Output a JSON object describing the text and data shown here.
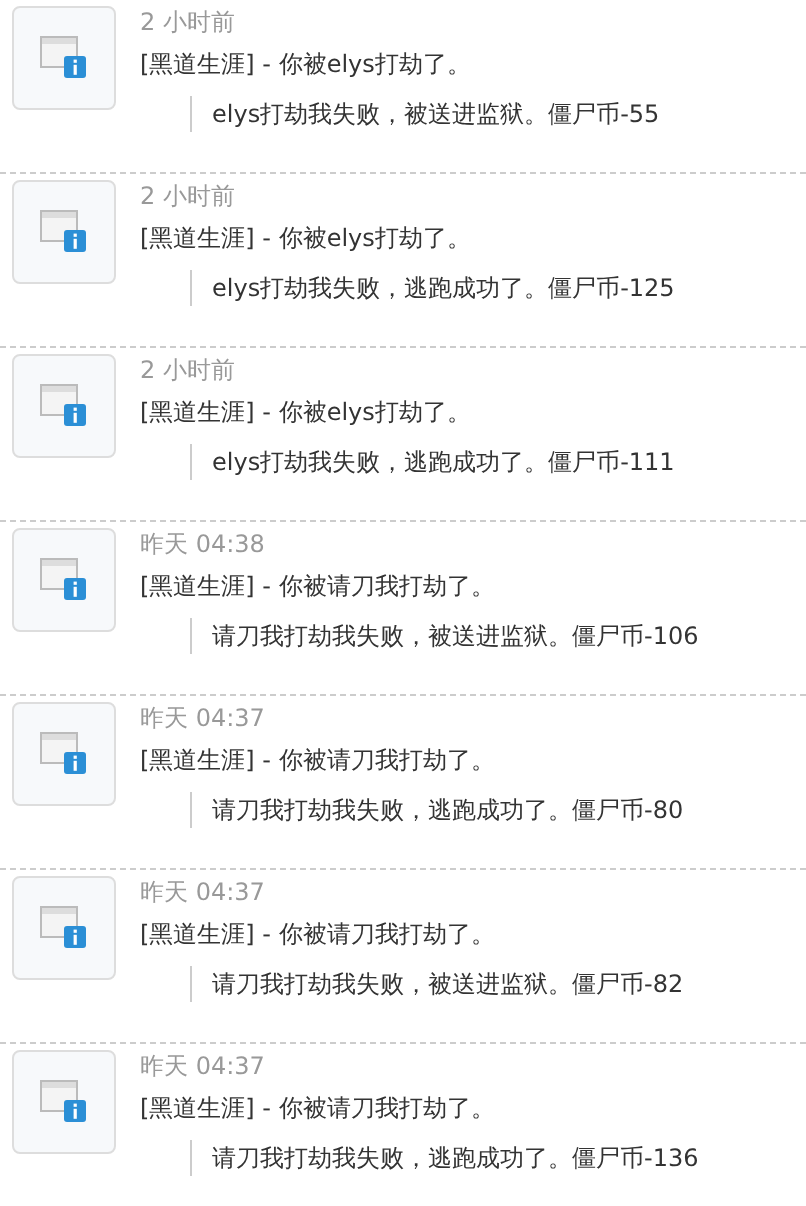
{
  "notices": [
    {
      "time": "2 小时前",
      "title": "[黑道生涯] - 你被elys打劫了。",
      "detail": "elys打劫我失败，被送进监狱。僵尸币-55"
    },
    {
      "time": "2 小时前",
      "title": "[黑道生涯] - 你被elys打劫了。",
      "detail": "elys打劫我失败，逃跑成功了。僵尸币-125"
    },
    {
      "time": "2 小时前",
      "title": "[黑道生涯] - 你被elys打劫了。",
      "detail": "elys打劫我失败，逃跑成功了。僵尸币-111"
    },
    {
      "time": "昨天 04:38",
      "title": "[黑道生涯] - 你被请刀我打劫了。",
      "detail": "请刀我打劫我失败，被送进监狱。僵尸币-106"
    },
    {
      "time": "昨天 04:37",
      "title": "[黑道生涯] - 你被请刀我打劫了。",
      "detail": "请刀我打劫我失败，逃跑成功了。僵尸币-80"
    },
    {
      "time": "昨天 04:37",
      "title": "[黑道生涯] - 你被请刀我打劫了。",
      "detail": "请刀我打劫我失败，被送进监狱。僵尸币-82"
    },
    {
      "time": "昨天 04:37",
      "title": "[黑道生涯] - 你被请刀我打劫了。",
      "detail": "请刀我打劫我失败，逃跑成功了。僵尸币-136"
    }
  ]
}
